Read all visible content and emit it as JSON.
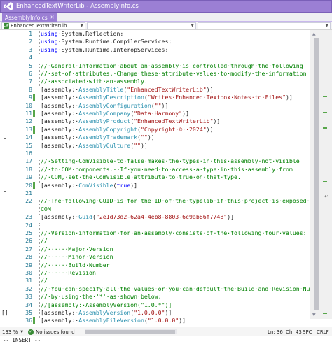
{
  "window": {
    "title": "EnhancedTextWriterLib - AssemblyInfo.cs",
    "accent": "#9b7fd4"
  },
  "tab": {
    "label": "AssemblyInfo.cs",
    "close_glyph": "✕"
  },
  "navbar": {
    "project": "EnhancedTextWriterLib",
    "type_member": "",
    "member": ""
  },
  "editor": {
    "lines": [
      {
        "n": "1",
        "changed": false,
        "tokens": [
          [
            "kw",
            "using"
          ],
          [
            "",
            "·System.Reflection;"
          ]
        ]
      },
      {
        "n": "2",
        "changed": false,
        "tokens": [
          [
            "kw",
            "using"
          ],
          [
            "",
            "·System.Runtime.CompilerServices;"
          ]
        ]
      },
      {
        "n": "3",
        "changed": false,
        "tokens": [
          [
            "kw",
            "using"
          ],
          [
            "",
            "·System.Runtime.InteropServices;"
          ]
        ]
      },
      {
        "n": "4",
        "changed": false,
        "tokens": []
      },
      {
        "n": "5",
        "changed": false,
        "tokens": [
          [
            "cm",
            "//·General·Information·about·an·assembly·is·controlled·through·the·following"
          ]
        ]
      },
      {
        "n": "6",
        "changed": false,
        "tokens": [
          [
            "cm",
            "//·set·of·attributes.·Change·these·attribute·values·to·modify·the·information"
          ]
        ]
      },
      {
        "n": "7",
        "changed": false,
        "tokens": [
          [
            "cm",
            "//·associated·with·an·assembly."
          ]
        ]
      },
      {
        "n": "8",
        "changed": false,
        "tokens": [
          [
            "",
            "[assembly:·"
          ],
          [
            "ty",
            "AssemblyTitle"
          ],
          [
            "",
            "("
          ],
          [
            "st",
            "\"EnhancedTextWriterLib\""
          ],
          [
            "",
            ")]"
          ]
        ]
      },
      {
        "n": "9",
        "changed": true,
        "tokens": [
          [
            "",
            "[assembly:·"
          ],
          [
            "ty",
            "AssemblyDescription"
          ],
          [
            "",
            "("
          ],
          [
            "st",
            "\"Writes·Enhanced·Textbox·Notes·to·Files\""
          ],
          [
            "",
            ")]"
          ]
        ]
      },
      {
        "n": "10",
        "changed": false,
        "tokens": [
          [
            "",
            "[assembly:·"
          ],
          [
            "ty",
            "AssemblyConfiguration"
          ],
          [
            "",
            "("
          ],
          [
            "st",
            "\"\""
          ],
          [
            "",
            ")]"
          ]
        ]
      },
      {
        "n": "11",
        "changed": true,
        "tokens": [
          [
            "",
            "[assembly:·"
          ],
          [
            "ty",
            "AssemblyCompany"
          ],
          [
            "",
            "("
          ],
          [
            "st",
            "\"Data·Harmony\""
          ],
          [
            "",
            ")]"
          ]
        ]
      },
      {
        "n": "12",
        "changed": false,
        "tokens": [
          [
            "",
            "[assembly:·"
          ],
          [
            "ty",
            "AssemblyProduct"
          ],
          [
            "",
            "("
          ],
          [
            "st",
            "\"EnhancedTextWriterLib\""
          ],
          [
            "",
            ")]"
          ]
        ]
      },
      {
        "n": "13",
        "changed": true,
        "tokens": [
          [
            "",
            "[assembly:·"
          ],
          [
            "ty",
            "AssemblyCopyright"
          ],
          [
            "",
            "("
          ],
          [
            "st",
            "\"Copyright·©··2024\""
          ],
          [
            "",
            ")]"
          ]
        ]
      },
      {
        "n": "14",
        "changed": false,
        "tokens": [
          [
            "",
            "[assembly:·"
          ],
          [
            "ty",
            "AssemblyTrademark"
          ],
          [
            "",
            "("
          ],
          [
            "st",
            "\"\""
          ],
          [
            "",
            ")]"
          ]
        ]
      },
      {
        "n": "15",
        "changed": false,
        "tokens": [
          [
            "",
            "[assembly:·"
          ],
          [
            "ty",
            "AssemblyCulture"
          ],
          [
            "",
            "("
          ],
          [
            "st",
            "\"\""
          ],
          [
            "",
            ")]"
          ]
        ]
      },
      {
        "n": "16",
        "changed": false,
        "tokens": []
      },
      {
        "n": "17",
        "changed": false,
        "tokens": [
          [
            "cm",
            "//·Setting·ComVisible·to·false·makes·the·types·in·this·assembly·not·visible"
          ]
        ]
      },
      {
        "n": "18",
        "changed": false,
        "tokens": [
          [
            "cm",
            "//·to·COM·components.··If·you·need·to·access·a·type·in·this·assembly·from"
          ]
        ]
      },
      {
        "n": "19",
        "changed": false,
        "tokens": [
          [
            "cm",
            "//·COM,·set·the·ComVisible·attribute·to·true·on·that·type."
          ]
        ]
      },
      {
        "n": "20",
        "changed": true,
        "tokens": [
          [
            "",
            "[assembly:·"
          ],
          [
            "ty",
            "ComVisible"
          ],
          [
            "",
            "("
          ],
          [
            "kw",
            "true"
          ],
          [
            "",
            ")]"
          ]
        ]
      },
      {
        "n": "21",
        "changed": false,
        "tokens": []
      },
      {
        "n": "22",
        "changed": false,
        "tokens": [
          [
            "cm",
            "//·The·following·GUID·is·for·the·ID·of·the·typelib·if·this·project·is·exposed·to·"
          ]
        ]
      },
      {
        "n": "",
        "changed": false,
        "tokens": [
          [
            "cm",
            "COM"
          ]
        ]
      },
      {
        "n": "23",
        "changed": false,
        "tokens": [
          [
            "",
            "[assembly:·"
          ],
          [
            "ty",
            "Guid"
          ],
          [
            "",
            "("
          ],
          [
            "st",
            "\"2e1d73d2-62a4-4eb8-8803-6c9ab86f7748\""
          ],
          [
            "",
            ")]"
          ]
        ]
      },
      {
        "n": "24",
        "changed": false,
        "tokens": []
      },
      {
        "n": "25",
        "changed": false,
        "tokens": [
          [
            "cm",
            "//·Version·information·for·an·assembly·consists·of·the·following·four·values:"
          ]
        ]
      },
      {
        "n": "26",
        "changed": false,
        "tokens": [
          [
            "cm",
            "//"
          ]
        ]
      },
      {
        "n": "27",
        "changed": false,
        "tokens": [
          [
            "cm",
            "//······Major·Version"
          ]
        ]
      },
      {
        "n": "28",
        "changed": false,
        "tokens": [
          [
            "cm",
            "//······Minor·Version"
          ]
        ]
      },
      {
        "n": "29",
        "changed": false,
        "tokens": [
          [
            "cm",
            "//······Build·Number"
          ]
        ]
      },
      {
        "n": "30",
        "changed": false,
        "tokens": [
          [
            "cm",
            "//······Revision"
          ]
        ]
      },
      {
        "n": "31",
        "changed": false,
        "tokens": [
          [
            "cm",
            "//"
          ]
        ]
      },
      {
        "n": "32",
        "changed": false,
        "tokens": [
          [
            "cm",
            "//·You·can·specify·all·the·values·or·you·can·default·the·Build·and·Revision·Numbers"
          ]
        ]
      },
      {
        "n": "33",
        "changed": false,
        "tokens": [
          [
            "cm",
            "//·by·using·the·'*'·as·shown·below:"
          ]
        ]
      },
      {
        "n": "34",
        "changed": false,
        "tokens": [
          [
            "cm",
            "//[assembly:·AssemblyVersion(\"1.0.*\")]"
          ]
        ]
      },
      {
        "n": "35",
        "changed": false,
        "tokens": [
          [
            "",
            "[assembly:·"
          ],
          [
            "ty",
            "AssemblyVersion"
          ],
          [
            "",
            "("
          ],
          [
            "st",
            "\"1.0.0.0\""
          ],
          [
            "",
            ")]"
          ]
        ]
      },
      {
        "n": "36",
        "changed": true,
        "tokens": [
          [
            "",
            "[assembly:·"
          ],
          [
            "ty",
            "AssemblyFileVersion"
          ],
          [
            "",
            "("
          ],
          [
            "st",
            "\"1.0.0.0\""
          ],
          [
            "",
            ")]"
          ]
        ]
      }
    ],
    "left_glyph_brackets": "[]",
    "wrap_glyph": "↩"
  },
  "status": {
    "zoom": "133 %",
    "issues": "No issues found",
    "line": "Ln: 36",
    "col": "Ch: 43",
    "spc": "SPC",
    "eol": "CRLF"
  },
  "vim": {
    "mode": "-- INSERT --"
  },
  "colors": {
    "keyword": "#0000ff",
    "comment": "#008000",
    "string": "#a31515",
    "type": "#2b91af",
    "line_number": "#237893",
    "change_bar": "#57a64a"
  }
}
